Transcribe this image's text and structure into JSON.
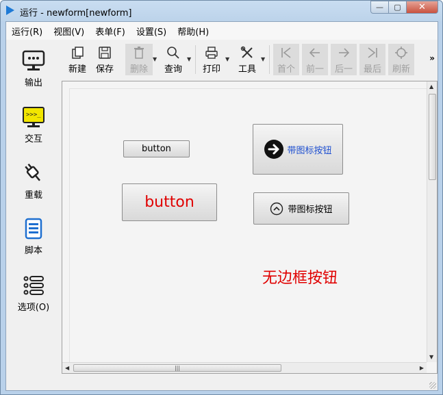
{
  "window": {
    "title": "运行 - newform[newform]",
    "buttons": {
      "minimize": "—",
      "maximize": "▢",
      "close": "✕"
    }
  },
  "menu": [
    "运行(R)",
    "视图(V)",
    "表单(F)",
    "设置(S)",
    "帮助(H)"
  ],
  "sidebar": [
    {
      "label": "输出",
      "icon": "monitor-icon"
    },
    {
      "label": "交互",
      "icon": "terminal-icon"
    },
    {
      "label": "重载",
      "icon": "plug-icon"
    },
    {
      "label": "脚本",
      "icon": "script-icon"
    },
    {
      "label": "选项(O)",
      "icon": "options-list-icon"
    }
  ],
  "toolbar": {
    "new": "新建",
    "save": "保存",
    "delete": "删除",
    "query": "查询",
    "print": "打印",
    "tools": "工具",
    "first": "首个",
    "prev": "前一",
    "next": "后一",
    "last": "最后",
    "refresh": "刷新",
    "more": "»"
  },
  "form": {
    "btn_small": "button",
    "btn_large": "button",
    "btn_icon_1": "带图标按钮",
    "btn_icon_2": "带图标按钮",
    "flat_button": "无边框按钮"
  },
  "colors": {
    "red_text": "#e00000",
    "blue_text": "#1e4fd0",
    "title_bar": "#bcd3ea"
  }
}
